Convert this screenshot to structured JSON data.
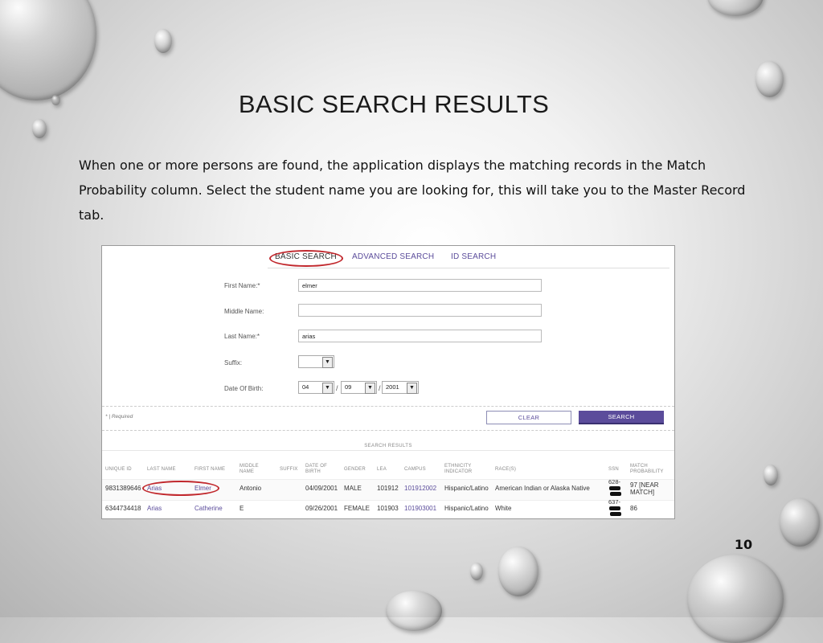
{
  "slide": {
    "title": "BASIC SEARCH RESULTS",
    "description": "When one or more persons are found, the application displays the matching records in the Match Probability column. Select the student name you are looking for, this will take you to the Master Record tab.",
    "page_number": "10"
  },
  "tabs": {
    "basic": "BASIC SEARCH",
    "advanced": "ADVANCED SEARCH",
    "id": "ID SEARCH"
  },
  "form": {
    "first_name_label": "First Name:*",
    "first_name_value": "elmer",
    "middle_name_label": "Middle Name:",
    "middle_name_value": "",
    "last_name_label": "Last Name:*",
    "last_name_value": "arias",
    "suffix_label": "Suffix:",
    "suffix_value": "",
    "dob_label": "Date Of Birth:",
    "dob_month": "04",
    "dob_day": "09",
    "dob_year": "2001",
    "dob_separator": "/",
    "required_note": "* | Required",
    "clear_label": "CLEAR",
    "search_label": "SEARCH"
  },
  "results": {
    "section_label": "SEARCH RESULTS",
    "columns": {
      "unique_id": "UNIQUE ID",
      "last_name": "LAST NAME",
      "first_name": "FIRST NAME",
      "middle_name": "MIDDLE NAME",
      "suffix": "SUFFIX",
      "dob": "DATE OF BIRTH",
      "gender": "GENDER",
      "lea": "LEA",
      "campus": "CAMPUS",
      "ethnicity": "ETHNICITY INDICATOR",
      "races": "RACE(S)",
      "ssn": "SSN",
      "match": "MATCH PROBABILITY"
    },
    "rows": [
      {
        "unique_id": "9831389646",
        "last_name": "Arias",
        "first_name": "Elmer",
        "middle_name": "Antonio",
        "dob": "04/09/2001",
        "gender": "MALE",
        "lea": "101912",
        "campus": "101912002",
        "ethnicity": "Hispanic/Latino",
        "races": "American Indian or Alaska Native",
        "ssn": "628-",
        "match": "97 [NEAR MATCH]"
      },
      {
        "unique_id": "6344734418",
        "last_name": "Arias",
        "first_name": "Catherine",
        "middle_name": "E",
        "dob": "09/26/2001",
        "gender": "FEMALE",
        "lea": "101903",
        "campus": "101903001",
        "ethnicity": "Hispanic/Latino",
        "races": "White",
        "ssn": "637-",
        "match": "86"
      }
    ]
  },
  "colors": {
    "accent": "#5b4c9b",
    "highlight_ring": "#c1282d"
  }
}
